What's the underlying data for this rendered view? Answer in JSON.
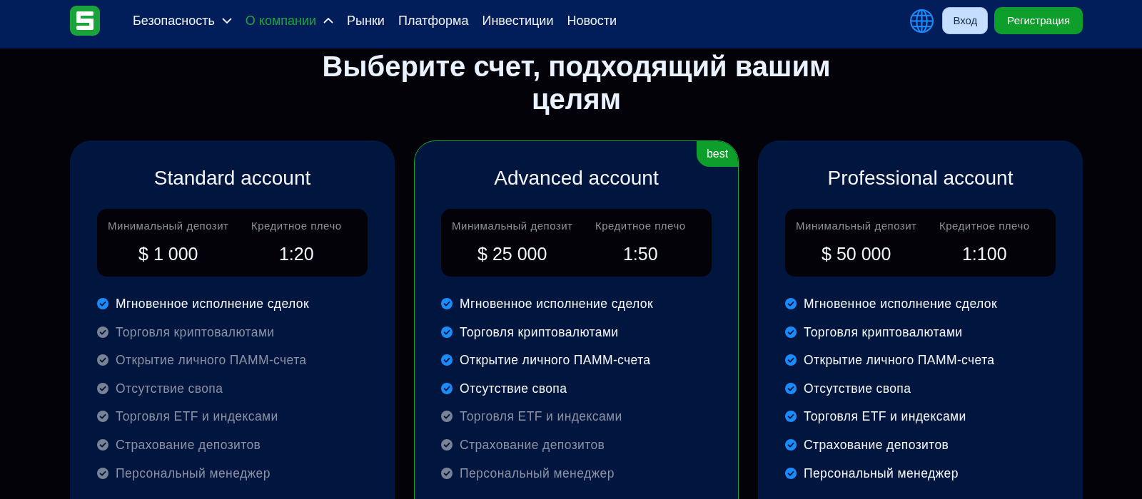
{
  "header": {
    "nav": [
      {
        "label": "Безопасность",
        "kind": "dropdown",
        "expanded": false,
        "selected": false
      },
      {
        "label": "О компании",
        "kind": "dropdown",
        "expanded": true,
        "selected": true
      },
      {
        "label": "Рынки",
        "kind": "link",
        "selected": false
      },
      {
        "label": "Платформа",
        "kind": "link",
        "selected": false
      },
      {
        "label": "Инвестиции",
        "kind": "link",
        "selected": false
      },
      {
        "label": "Новости",
        "kind": "link",
        "selected": false
      }
    ],
    "buttons": [
      {
        "label": "Вход",
        "kind": "secondary"
      },
      {
        "label": "Регистрация",
        "kind": "primary"
      }
    ]
  },
  "heading": "Выберите счет, подходящий вашим целям",
  "plans": [
    {
      "title": "Standard account",
      "featured": false,
      "stats": [
        {
          "label": "Минимальный депозит",
          "value": "$ 1 000"
        },
        {
          "label": "Кредитное плечо",
          "value": "1:20"
        }
      ],
      "features": [
        {
          "label": "Мгновенное исполнение сделок",
          "included": true
        },
        {
          "label": "Торговля криптовалютами",
          "included": false
        },
        {
          "label": "Открытие личного ПАММ-счета",
          "included": false
        },
        {
          "label": "Отсутствие свопа",
          "included": false
        },
        {
          "label": "Торговля ETF и индексами",
          "included": false
        },
        {
          "label": "Страхование депозитов",
          "included": false
        },
        {
          "label": "Персональный менеджер",
          "included": false
        }
      ]
    },
    {
      "title": "Advanced account",
      "featured": true,
      "badge": "best",
      "stats": [
        {
          "label": "Минимальный депозит",
          "value": "$ 25 000"
        },
        {
          "label": "Кредитное плечо",
          "value": "1:50"
        }
      ],
      "features": [
        {
          "label": "Мгновенное исполнение сделок",
          "included": true
        },
        {
          "label": "Торговля криптовалютами",
          "included": true
        },
        {
          "label": "Открытие личного ПАММ-счета",
          "included": true
        },
        {
          "label": "Отсутствие свопа",
          "included": true
        },
        {
          "label": "Торговля ETF и индексами",
          "included": false
        },
        {
          "label": "Страхование депозитов",
          "included": false
        },
        {
          "label": "Персональный менеджер",
          "included": false
        }
      ]
    },
    {
      "title": "Professional account",
      "featured": false,
      "stats": [
        {
          "label": "Минимальный депозит",
          "value": "$ 50 000"
        },
        {
          "label": "Кредитное плечо",
          "value": "1:100"
        }
      ],
      "features": [
        {
          "label": "Мгновенное исполнение сделок",
          "included": true
        },
        {
          "label": "Торговля криптовалютами",
          "included": true
        },
        {
          "label": "Открытие личного ПАММ-счета",
          "included": true
        },
        {
          "label": "Отсутствие свопа",
          "included": true
        },
        {
          "label": "Торговля ETF и индексами",
          "included": true
        },
        {
          "label": "Страхование депозитов",
          "included": true
        },
        {
          "label": "Персональный менеджер",
          "included": true
        }
      ]
    }
  ]
}
